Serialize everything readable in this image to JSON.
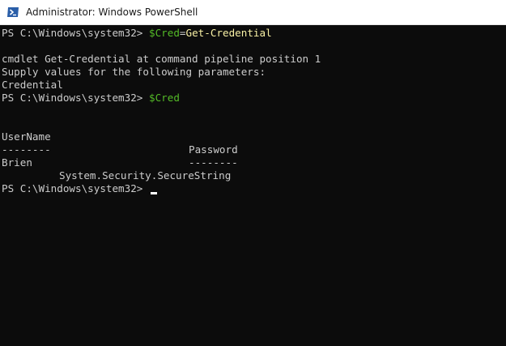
{
  "window": {
    "title": "Administrator: Windows PowerShell"
  },
  "console": {
    "lines": [
      {
        "prompt": "PS C:\\Windows\\system32> ",
        "variable": "$Cred",
        "operator": "=",
        "command": "Get-Credential"
      },
      {
        "text": "cmdlet Get-Credential at command pipeline position 1"
      },
      {
        "text": "Supply values for the following parameters:"
      },
      {
        "text": "Credential"
      },
      {
        "prompt": "PS C:\\Windows\\system32> ",
        "variable": "$Cred"
      }
    ],
    "table": {
      "headers": [
        "UserName",
        "Password"
      ],
      "separators": [
        "--------",
        "--------"
      ],
      "rows": [
        [
          "Brien",
          "System.Security.SecureString"
        ]
      ]
    },
    "final_prompt": "PS C:\\Windows\\system32> "
  },
  "colors": {
    "background": "#0c0c0c",
    "text": "#cccccc",
    "variable": "#54bb27",
    "command": "#f9f1a5"
  },
  "icons": {
    "app": "powershell-icon"
  }
}
